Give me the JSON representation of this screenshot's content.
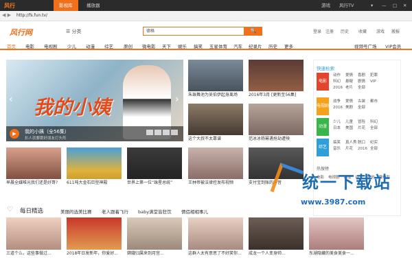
{
  "window": {
    "brand": "风行",
    "tabs": [
      "影视库",
      "播放器"
    ],
    "right_items": [
      "游戏",
      "风行TV",
      "▾",
      "—",
      "□",
      "✕"
    ]
  },
  "address": {
    "url": "http://fs.fun.tv/"
  },
  "header": {
    "brand": "风行网",
    "category_menu": "分类",
    "search_value": "德格",
    "search_button": "🔍",
    "util": [
      "登录",
      "注册",
      "历史",
      "收藏",
      "游戏",
      "搬报"
    ]
  },
  "category_nav": {
    "items": [
      "首页",
      "电影",
      "电视剧",
      "少儿",
      "动漫",
      "综艺",
      "原创",
      "微电影",
      "天下",
      "娱乐",
      "搞笑",
      "五星体育",
      "汽车",
      "纪录片",
      "历史",
      "更多"
    ],
    "right": [
      "视频号广场",
      "VIP会员"
    ]
  },
  "hero": {
    "title_art": "我的小姨",
    "caption_title": "我的小姨（全56集）",
    "caption_sub": "扒人就要跟好朋友打头阵",
    "prev": "‹",
    "next": "›"
  },
  "grid_top": [
    {
      "caption": "朱珠舞池为吴伯伊起身离场",
      "tag": "第一集大结局 [更新至56集]"
    },
    {
      "caption": "2016年3月 [更新至56集]",
      "tag": "2016年3月"
    },
    {
      "caption": "这个大叔不太靠谱",
      "tag": ""
    },
    {
      "caption": "范冰冰杨幂遇抢劫遭殃",
      "tag": "2017"
    },
    {
      "caption": "恩佳乌克满赞扮演",
      "tag": ""
    },
    {
      "caption": "冯潇林哥最美的恋爱",
      "tag": ""
    }
  ],
  "grid_mid": [
    {
      "caption": "早晨全媒唯光我们还是好哥?",
      "tag": "看看你们会怎么做呀"
    },
    {
      "caption": "611吨大金石巨型神殿",
      "tag": "千年未解释密阵印记"
    },
    {
      "caption": "世界上第一位“珠星总统”",
      "tag": "跨境电商"
    },
    {
      "caption": "王林帝被法律控发布视频",
      "tag": ""
    },
    {
      "caption": "支付宝到账的声音",
      "tag": ""
    }
  ],
  "sidebar": {
    "heading": "快速检索",
    "blocks": [
      {
        "label": "电影",
        "color": "#e2452b",
        "rows": [
          [
            "动作",
            "爱情",
            "喜剧",
            "犯罪"
          ],
          [
            "科幻",
            "悬疑",
            "剧情",
            "VIP"
          ],
          [
            "2016",
            "老片",
            "全部",
            ""
          ]
        ]
      },
      {
        "label": "电视剧",
        "color": "#f5a21a",
        "rows": [
          [
            "战争",
            "爱情",
            "古装",
            "都市"
          ],
          [
            "2016",
            "美剧",
            "全部",
            ""
          ]
        ]
      },
      {
        "label": "动漫",
        "color": "#39b54a",
        "rows": [
          [
            "少儿",
            "儿童",
            "冒险",
            "科幻"
          ],
          [
            "日本",
            "美国",
            "片花",
            "全部"
          ]
        ]
      },
      {
        "label": "综艺",
        "color": "#2f9fd9",
        "rows": [
          [
            "搞笑",
            "真人秀",
            "脱口",
            "纪实"
          ],
          [
            "音乐",
            "片花",
            "2016",
            "全部"
          ]
        ]
      }
    ],
    "hot_heading": "热搜榜",
    "hot": [
      "电影",
      "电视剧",
      "动漫",
      "综艺",
      "原创",
      "微电影"
    ]
  },
  "daily": {
    "heading": "每日精选",
    "tags": [
      "美丽的选美比赛",
      "老人跟着飞行",
      "baby满堂皆狂饮",
      "情侣相相事儿"
    ]
  },
  "grid_bottom": [
    {
      "caption": "三道个么，这些事做过..."
    },
    {
      "caption": "2018年日发新年，你爱好..."
    },
    {
      "caption": "嫦娥归属来到月宫..."
    },
    {
      "caption": "这群人太有意思了不好笑你..."
    },
    {
      "caption": "成龙一个人变身帅..."
    },
    {
      "caption": "东湖隐藏的美食美食一..."
    }
  ],
  "watermark": {
    "big": "统一下载站",
    "small": "www.3987.com"
  },
  "colors": {
    "accent": "#f0701c",
    "titlebar": "#2b2b2b",
    "link_blue": "#2f9fd9"
  }
}
